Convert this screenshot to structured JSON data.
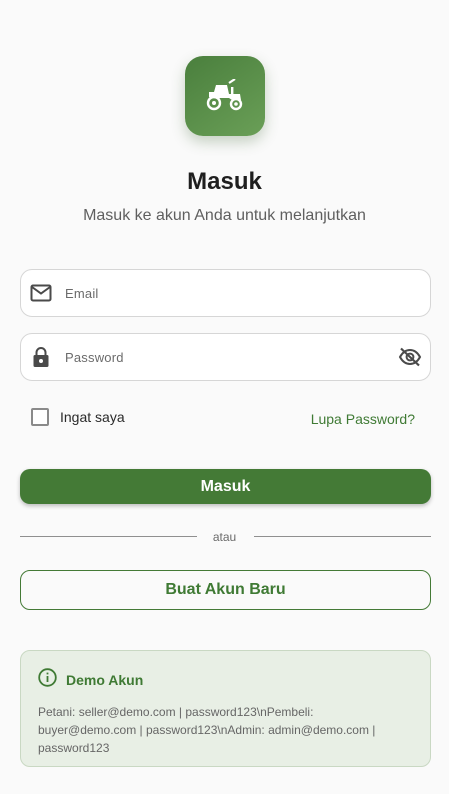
{
  "header": {
    "logo_icon": "tractor-icon",
    "title": "Masuk",
    "subtitle": "Masuk ke akun Anda untuk melanjutkan"
  },
  "form": {
    "email": {
      "placeholder": "Email",
      "value": "",
      "icon": "email-icon"
    },
    "password": {
      "placeholder": "Password",
      "value": "",
      "icon": "lock-icon",
      "toggle_icon": "visibility-off-icon"
    },
    "remember_label": "Ingat saya",
    "remember_checked": false,
    "forgot_label": "Lupa Password?",
    "submit_label": "Masuk",
    "divider_label": "atau",
    "register_label": "Buat Akun Baru"
  },
  "demo": {
    "icon": "info-icon",
    "title": "Demo Akun",
    "body": "Petani: seller@demo.com | password123\\nPembeli: buyer@demo.com | password123\\nAdmin: admin@demo.com | password123"
  },
  "colors": {
    "primary": "#447a36",
    "background": "#fafafa",
    "demo_background": "#e8efe5"
  }
}
